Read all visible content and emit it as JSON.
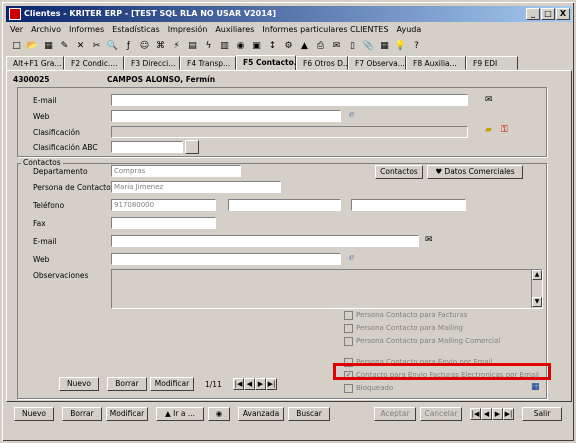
{
  "window": {
    "title": "Clientes - KRITER ERP - [TEST SQL RLA NO USAR V2014]",
    "min": "_",
    "max": "□",
    "close": "X"
  },
  "menu": [
    "Ver",
    "Archivo",
    "Informes",
    "Estadísticas",
    "Impresión",
    "Auxiliares",
    "Informes particulares CLIENTES",
    "Ayuda"
  ],
  "toolbar_icons": [
    "new-doc-icon",
    "open-icon",
    "save-icon",
    "edit-icon",
    "delete-icon",
    "cut-icon",
    "search-icon",
    "brush-icon",
    "people-icon",
    "filter-icon",
    "link-icon",
    "table-icon",
    "lightning-icon",
    "calculator-icon",
    "camera-icon",
    "card-icon",
    "sort-icon",
    "plugin-icon",
    "chart-icon",
    "print-icon",
    "mail-icon",
    "doc-icon",
    "attach-icon",
    "grid-icon",
    "bulb-icon",
    "help-icon"
  ],
  "toolbar_glyphs": [
    "□",
    "📂",
    "▦",
    "✎",
    "✕",
    "✂",
    "🔍",
    "ƒ",
    "☺",
    "⌘",
    "⚡",
    "▤",
    "ϟ",
    "▥",
    "◉",
    "▣",
    "↕",
    "⚙",
    "▲",
    "⎙",
    "✉",
    "▯",
    "📎",
    "▦",
    "💡",
    "?"
  ],
  "tabs": [
    "Alt+F1 Gra...",
    "F2 Condic....",
    "F3 Direcci...",
    "F4 Transp...",
    "F5 Contacto...",
    "F6 Otros D...",
    "F7 Observa...",
    "F8 Auxilia...",
    "F9 EDI"
  ],
  "client": {
    "code": "4300025",
    "name": "CAMPOS ALONSO, Fermín"
  },
  "general": {
    "email_label": "E-mail",
    "web_label": "Web",
    "clasif_label": "Clasificación",
    "clasif_abc_label": "Clasificación ABC",
    "email": "",
    "web": "",
    "clasif": "",
    "clasif_abc": ""
  },
  "contactos": {
    "group_label": "Contactos",
    "depto_label": "Departamento",
    "depto": "Compras",
    "persona_label": "Persona de Contacto",
    "persona": "Maria Jimenez",
    "tel_label": "Teléfono",
    "tel": "917080000",
    "fax_label": "Fax",
    "fax": "",
    "email_label": "E-mail",
    "email": "",
    "web_label": "Web",
    "web": "",
    "obs_label": "Observaciones",
    "obs": "",
    "btn_contactos": "Contactos",
    "btn_datos": "Datos Comerciales"
  },
  "checks": [
    {
      "label": "Persona Contacto para Facturas",
      "checked": false
    },
    {
      "label": "Persona Contacto para Mailing",
      "checked": false
    },
    {
      "label": "Persona Contacto para Mailing Comercial",
      "checked": false
    },
    {
      "label": "Persona Contacto para Envío por Email",
      "checked": false
    },
    {
      "label": "Contacto para Envio Facturas Electronicas por Email",
      "checked": true
    },
    {
      "label": "Bloqueado",
      "checked": false
    }
  ],
  "inner_buttons": {
    "nuevo": "Nuevo",
    "borrar": "Borrar",
    "modificar": "Modificar",
    "counter": "1/11"
  },
  "bottom": {
    "nuevo": "Nuevo",
    "borrar": "Borrar",
    "modificar": "Modificar",
    "ira": "Ir a ...",
    "avanzada": "Avanzada",
    "buscar": "Buscar",
    "aceptar": "Aceptar",
    "cancelar": "Cancelar",
    "salir": "Salir"
  }
}
